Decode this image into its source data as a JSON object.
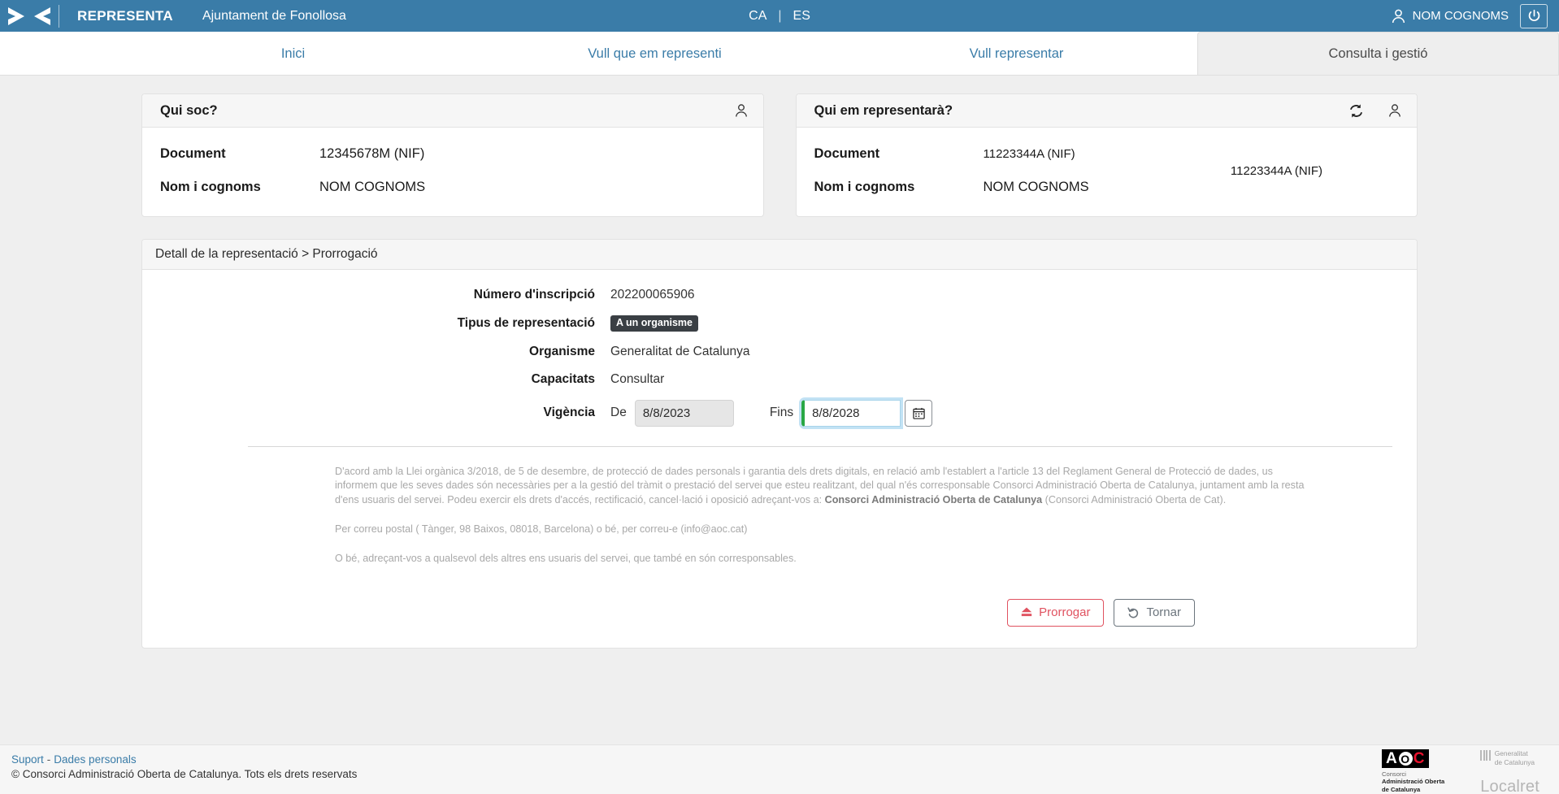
{
  "topbar": {
    "logo_icon": "representa-arrows-logo",
    "brand": "REPRESENTA",
    "org": "Ajuntament de Fonollosa",
    "lang_ca": "CA",
    "lang_sep": "|",
    "lang_es": "ES",
    "user_icon": "person-icon",
    "user_name": "NOM COGNOMS",
    "logout_icon": "power-icon",
    "bg_color": "#3a7ca8"
  },
  "nav": {
    "tabs": [
      {
        "label": "Inici",
        "active": false
      },
      {
        "label": "Vull que em representi",
        "active": false
      },
      {
        "label": "Vull representar",
        "active": false
      },
      {
        "label": "Consulta i gestió",
        "active": true
      }
    ]
  },
  "card_left": {
    "title": "Qui soc?",
    "header_icon": "person-icon",
    "rows": [
      {
        "key": "Document",
        "value": "12345678M (NIF)"
      },
      {
        "key": "Nom i cognoms",
        "value": "NOM COGNOMS"
      }
    ]
  },
  "card_right": {
    "title": "Qui em representarà?",
    "header_icon_refresh": "refresh-icon",
    "header_icon_person": "person-icon",
    "rows": [
      {
        "key": "Document",
        "value": "11223344A (NIF)"
      },
      {
        "key": "Nom i cognoms",
        "value": "NOM COGNOMS"
      }
    ],
    "floating_nif": "11223344A (NIF)"
  },
  "panel": {
    "breadcrumb": "Detall de la representació > Prorrogació",
    "fields": [
      {
        "label": "Número d'inscripció",
        "value": "202200065906",
        "type": "text"
      },
      {
        "label": "Tipus de representació",
        "value": "A un organisme",
        "type": "badge"
      },
      {
        "label": "Organisme",
        "value": "Generalitat de Catalunya",
        "type": "text"
      },
      {
        "label": "Capacitats",
        "value": "Consultar",
        "type": "text"
      }
    ],
    "validity": {
      "label": "Vigència",
      "from_label": "De",
      "from_value": "8/8/2023",
      "to_label": "Fins",
      "to_value": "8/8/2028",
      "calendar_icon": "calendar-icon",
      "focus_accent_color": "#28a745"
    },
    "legal": {
      "p1_a": "D'acord amb la Llei orgànica 3/2018, de 5 de desembre, de protecció de dades personals i garantia dels drets digitals, en relació amb l'establert a l'article 13 del Reglament General de Protecció de dades, us informem que les seves dades són necessàries per a la gestió del tràmit o prestació del servei que esteu realitzant, del qual n'és corresponsable Consorci Administració Oberta de Catalunya, juntament amb la resta d'ens usuaris del servei. Podeu exercir els drets d'accés, rectificació, cancel·lació i oposició adreçant-vos a: ",
      "p1_b": "Consorci Administració Oberta de Catalunya",
      "p1_c": " (Consorci Administració Oberta de Cat).",
      "p2": "Per correu postal ( Tànger, 98 Baixos, 08018, Barcelona) o bé, per correu-e (info@aoc.cat)",
      "p3": "O bé, adreçant-vos a qualsevol dels altres ens usuaris del servei, que també en són corresponsables."
    },
    "buttons": {
      "primary_label": "Prorrogar",
      "primary_icon": "eject-icon",
      "primary_color": "#e05260",
      "secondary_label": "Tornar",
      "secondary_icon": "undo-icon",
      "secondary_color": "#6c757d"
    }
  },
  "footer": {
    "link_support": "Suport",
    "link_dash": "-",
    "link_data": "Dades personals",
    "copyright": "© Consorci Administració Oberta de Catalunya. Tots els drets reservats",
    "aoc": {
      "mark_a": "A",
      "mark_o": "O",
      "mark_c": "C",
      "line1": "Consorci",
      "line2": "Administració Oberta",
      "line3": "de Catalunya"
    },
    "generalitat": {
      "line1": "Generalitat",
      "line2": "de Catalunya"
    },
    "localret": "Localret"
  }
}
